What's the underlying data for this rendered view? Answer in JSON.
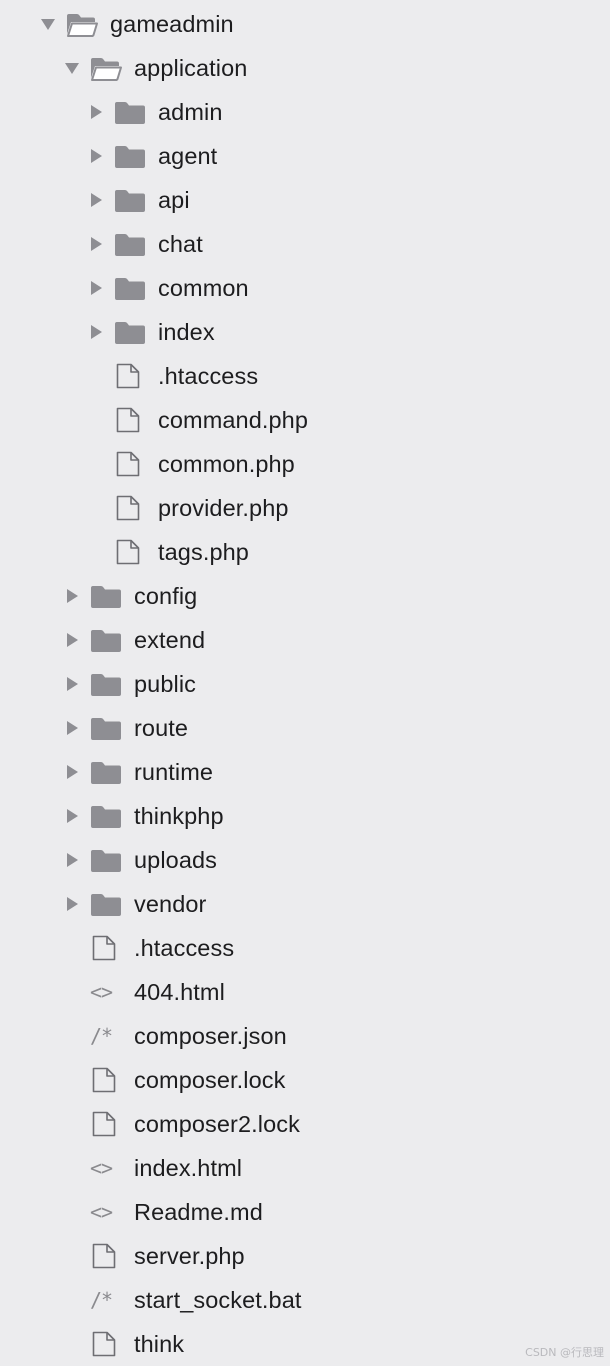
{
  "colors": {
    "background": "#ececee",
    "folder_icon": "#8e8e93",
    "chevron": "#8e8e93",
    "file_icon_stroke": "#6e6e73",
    "text": "#1d1d1f"
  },
  "tree": [
    {
      "depth": 0,
      "type": "folder",
      "expanded": true,
      "label": "gameadmin",
      "icon": "folder-open-icon"
    },
    {
      "depth": 1,
      "type": "folder",
      "expanded": true,
      "label": "application",
      "icon": "folder-open-icon"
    },
    {
      "depth": 2,
      "type": "folder",
      "expanded": false,
      "label": "admin",
      "icon": "folder-icon"
    },
    {
      "depth": 2,
      "type": "folder",
      "expanded": false,
      "label": "agent",
      "icon": "folder-icon"
    },
    {
      "depth": 2,
      "type": "folder",
      "expanded": false,
      "label": "api",
      "icon": "folder-icon"
    },
    {
      "depth": 2,
      "type": "folder",
      "expanded": false,
      "label": "chat",
      "icon": "folder-icon"
    },
    {
      "depth": 2,
      "type": "folder",
      "expanded": false,
      "label": "common",
      "icon": "folder-icon"
    },
    {
      "depth": 2,
      "type": "folder",
      "expanded": false,
      "label": "index",
      "icon": "folder-icon"
    },
    {
      "depth": 2,
      "type": "file",
      "label": ".htaccess",
      "icon": "file-icon"
    },
    {
      "depth": 2,
      "type": "file",
      "label": "command.php",
      "icon": "file-icon"
    },
    {
      "depth": 2,
      "type": "file",
      "label": "common.php",
      "icon": "file-icon"
    },
    {
      "depth": 2,
      "type": "file",
      "label": "provider.php",
      "icon": "file-icon"
    },
    {
      "depth": 2,
      "type": "file",
      "label": "tags.php",
      "icon": "file-icon"
    },
    {
      "depth": 1,
      "type": "folder",
      "expanded": false,
      "label": "config",
      "icon": "folder-icon"
    },
    {
      "depth": 1,
      "type": "folder",
      "expanded": false,
      "label": "extend",
      "icon": "folder-icon"
    },
    {
      "depth": 1,
      "type": "folder",
      "expanded": false,
      "label": "public",
      "icon": "folder-icon"
    },
    {
      "depth": 1,
      "type": "folder",
      "expanded": false,
      "label": "route",
      "icon": "folder-icon"
    },
    {
      "depth": 1,
      "type": "folder",
      "expanded": false,
      "label": "runtime",
      "icon": "folder-icon"
    },
    {
      "depth": 1,
      "type": "folder",
      "expanded": false,
      "label": "thinkphp",
      "icon": "folder-icon"
    },
    {
      "depth": 1,
      "type": "folder",
      "expanded": false,
      "label": "uploads",
      "icon": "folder-icon"
    },
    {
      "depth": 1,
      "type": "folder",
      "expanded": false,
      "label": "vendor",
      "icon": "folder-icon"
    },
    {
      "depth": 1,
      "type": "file",
      "label": ".htaccess",
      "icon": "file-icon"
    },
    {
      "depth": 1,
      "type": "code",
      "label": "404.html",
      "icon": "code-brackets-icon",
      "glyph": "<>"
    },
    {
      "depth": 1,
      "type": "code",
      "label": "composer.json",
      "icon": "comment-icon",
      "glyph": "/*"
    },
    {
      "depth": 1,
      "type": "file",
      "label": "composer.lock",
      "icon": "file-icon"
    },
    {
      "depth": 1,
      "type": "file",
      "label": "composer2.lock",
      "icon": "file-icon"
    },
    {
      "depth": 1,
      "type": "code",
      "label": "index.html",
      "icon": "code-brackets-icon",
      "glyph": "<>"
    },
    {
      "depth": 1,
      "type": "code",
      "label": "Readme.md",
      "icon": "code-brackets-icon",
      "glyph": "<>"
    },
    {
      "depth": 1,
      "type": "file",
      "label": "server.php",
      "icon": "file-icon"
    },
    {
      "depth": 1,
      "type": "code",
      "label": "start_socket.bat",
      "icon": "comment-icon",
      "glyph": "/*"
    },
    {
      "depth": 1,
      "type": "file",
      "label": "think",
      "icon": "file-icon"
    }
  ],
  "watermark": "CSDN @行思理"
}
